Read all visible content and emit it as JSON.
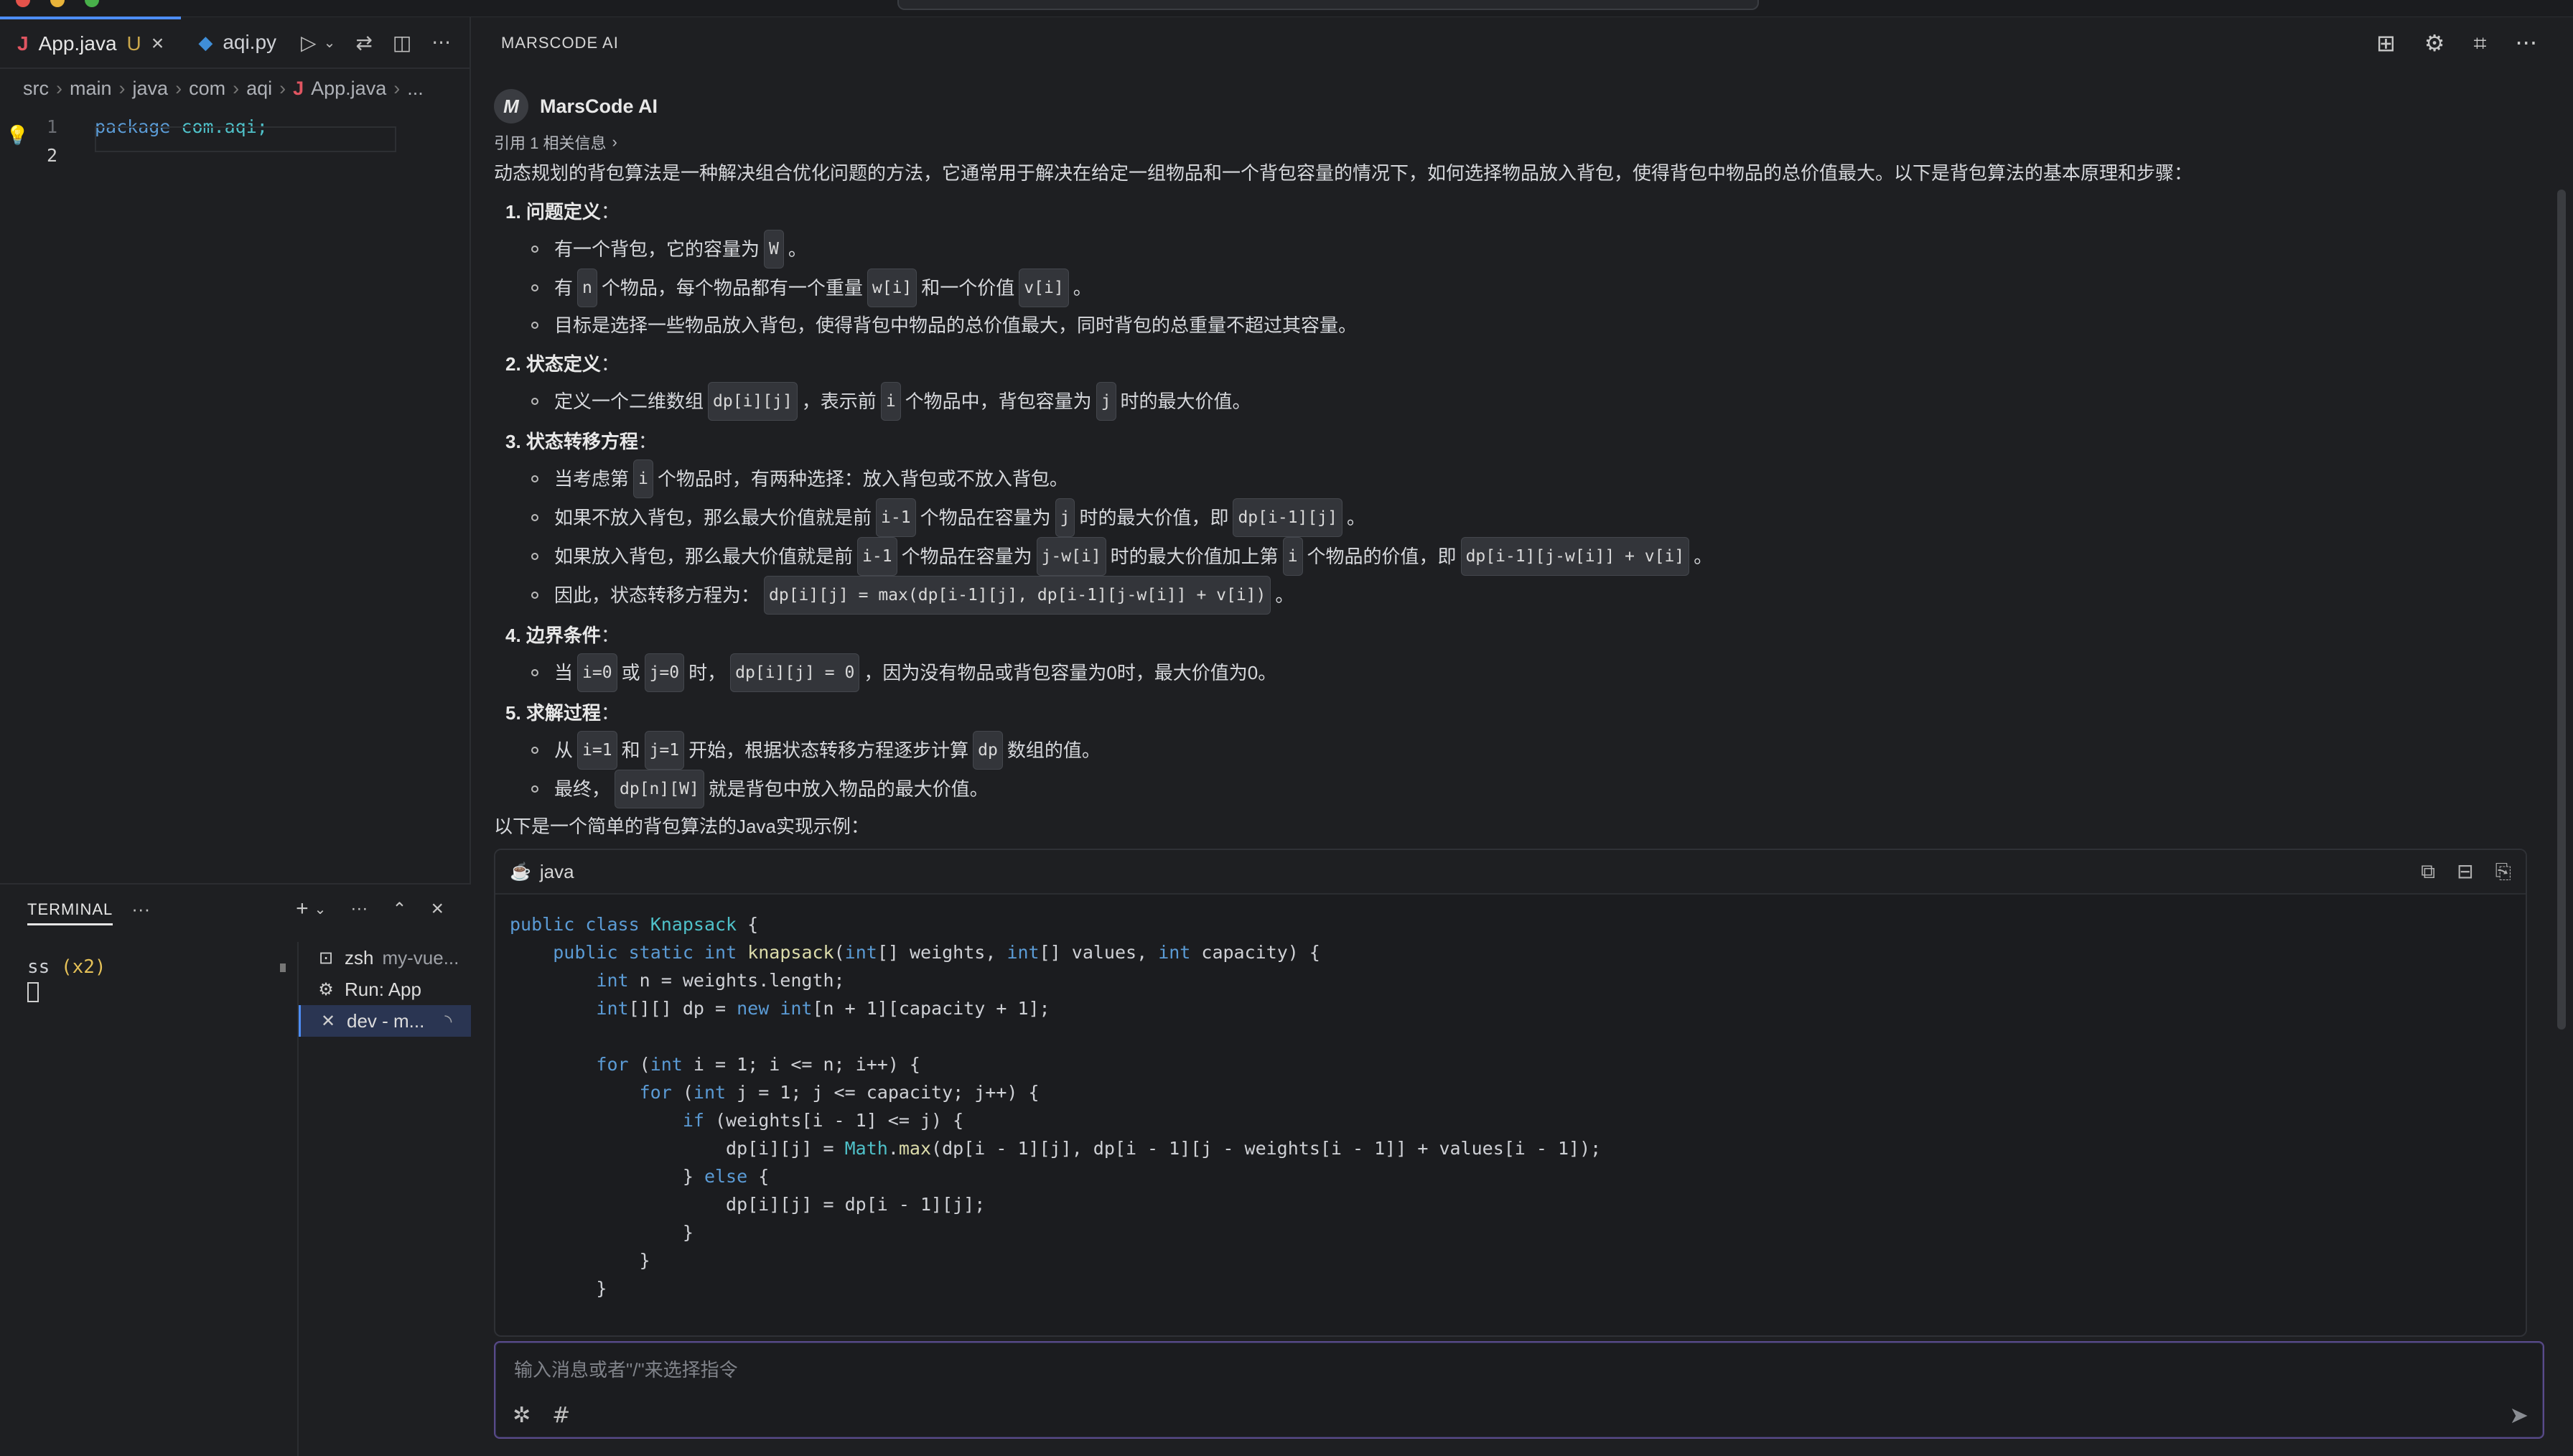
{
  "editor": {
    "tabs": [
      {
        "label": "App.java",
        "modified": "U",
        "active": true
      },
      {
        "label": "aqi.py",
        "active": false
      }
    ],
    "breadcrumb": [
      "src",
      "main",
      "java",
      "com",
      "aqi",
      "App.java",
      "..."
    ],
    "lines": [
      {
        "num": "1",
        "kw": "package",
        "rest": "com.aqi;"
      },
      {
        "num": "2",
        "kw": "",
        "rest": ""
      }
    ]
  },
  "terminal": {
    "title": "TERMINAL",
    "output_text": "ss",
    "output_count": "(x2)",
    "sessions": [
      {
        "name": "zsh",
        "detail": "my-vue..."
      },
      {
        "name": "Run: App",
        "detail": ""
      },
      {
        "name": "dev - m...",
        "detail": ""
      }
    ]
  },
  "chat": {
    "title": "MARSCODE AI",
    "author": "MarsCode AI",
    "reference": "引用 1 相关信息",
    "intro": "动态规划的背包算法是一种解决组合优化问题的方法，它通常用于解决在给定一组物品和一个背包容量的情况下，如何选择物品放入背包，使得背包中物品的总价值最大。以下是背包算法的基本原理和步骤：",
    "s1": {
      "title": "1. 问题定义",
      "b1a": "有一个背包，它的容量为",
      "b1c": "W",
      "b1b": "。",
      "b2a": "有",
      "b2c1": "n",
      "b2b": "个物品，每个物品都有一个重量",
      "b2c2": "w[i]",
      "b2d": "和一个价值",
      "b2c3": "v[i]",
      "b2e": "。",
      "b3": "目标是选择一些物品放入背包，使得背包中物品的总价值最大，同时背包的总重量不超过其容量。"
    },
    "s2": {
      "title": "2. 状态定义",
      "a": "定义一个二维数组",
      "c1": "dp[i][j]",
      "b": "，表示前",
      "c2": "i",
      "d": "个物品中，背包容量为",
      "c3": "j",
      "e": "时的最大价值。"
    },
    "s3": {
      "title": "3. 状态转移方程",
      "b1a": "当考虑第",
      "b1c": "i",
      "b1b": "个物品时，有两种选择：放入背包或不放入背包。",
      "b2a": "如果不放入背包，那么最大价值就是前",
      "b2c1": "i-1",
      "b2b": "个物品在容量为",
      "b2c2": "j",
      "b2d": "时的最大价值，即",
      "b2c3": "dp[i-1][j]",
      "b2e": "。",
      "b3a": "如果放入背包，那么最大价值就是前",
      "b3c1": "i-1",
      "b3b": "个物品在容量为",
      "b3c2": "j-w[i]",
      "b3d": "时的最大价值加上第",
      "b3c3": "i",
      "b3e": "个物品的价值，即",
      "b3c4": "dp[i-1][j-w[i]] + v[i]",
      "b3f": "。",
      "b4a": "因此，状态转移方程为：",
      "b4c": "dp[i][j] = max(dp[i-1][j], dp[i-1][j-w[i]] + v[i])",
      "b4b": "。"
    },
    "s4": {
      "title": "4. 边界条件",
      "a": "当",
      "c1": "i=0",
      "b": "或",
      "c2": "j=0",
      "d": "时，",
      "c3": "dp[i][j] = 0",
      "e": "，因为没有物品或背包容量为0时，最大价值为0。"
    },
    "s5": {
      "title": "5. 求解过程",
      "b1a": "从",
      "b1c1": "i=1",
      "b1b": "和",
      "b1c2": "j=1",
      "b1d": "开始，根据状态转移方程逐步计算",
      "b1c3": "dp",
      "b1e": "数组的值。",
      "b2a": "最终，",
      "b2c": "dp[n][W]",
      "b2b": "就是背包中放入物品的最大价值。"
    },
    "outro": "以下是一个简单的背包算法的Java实现示例：",
    "code_lang": "java",
    "input_placeholder": "输入消息或者\"/\"来选择指令"
  },
  "colors": {
    "accent": "#4d8df6",
    "input_border": "#5a4a8a"
  }
}
